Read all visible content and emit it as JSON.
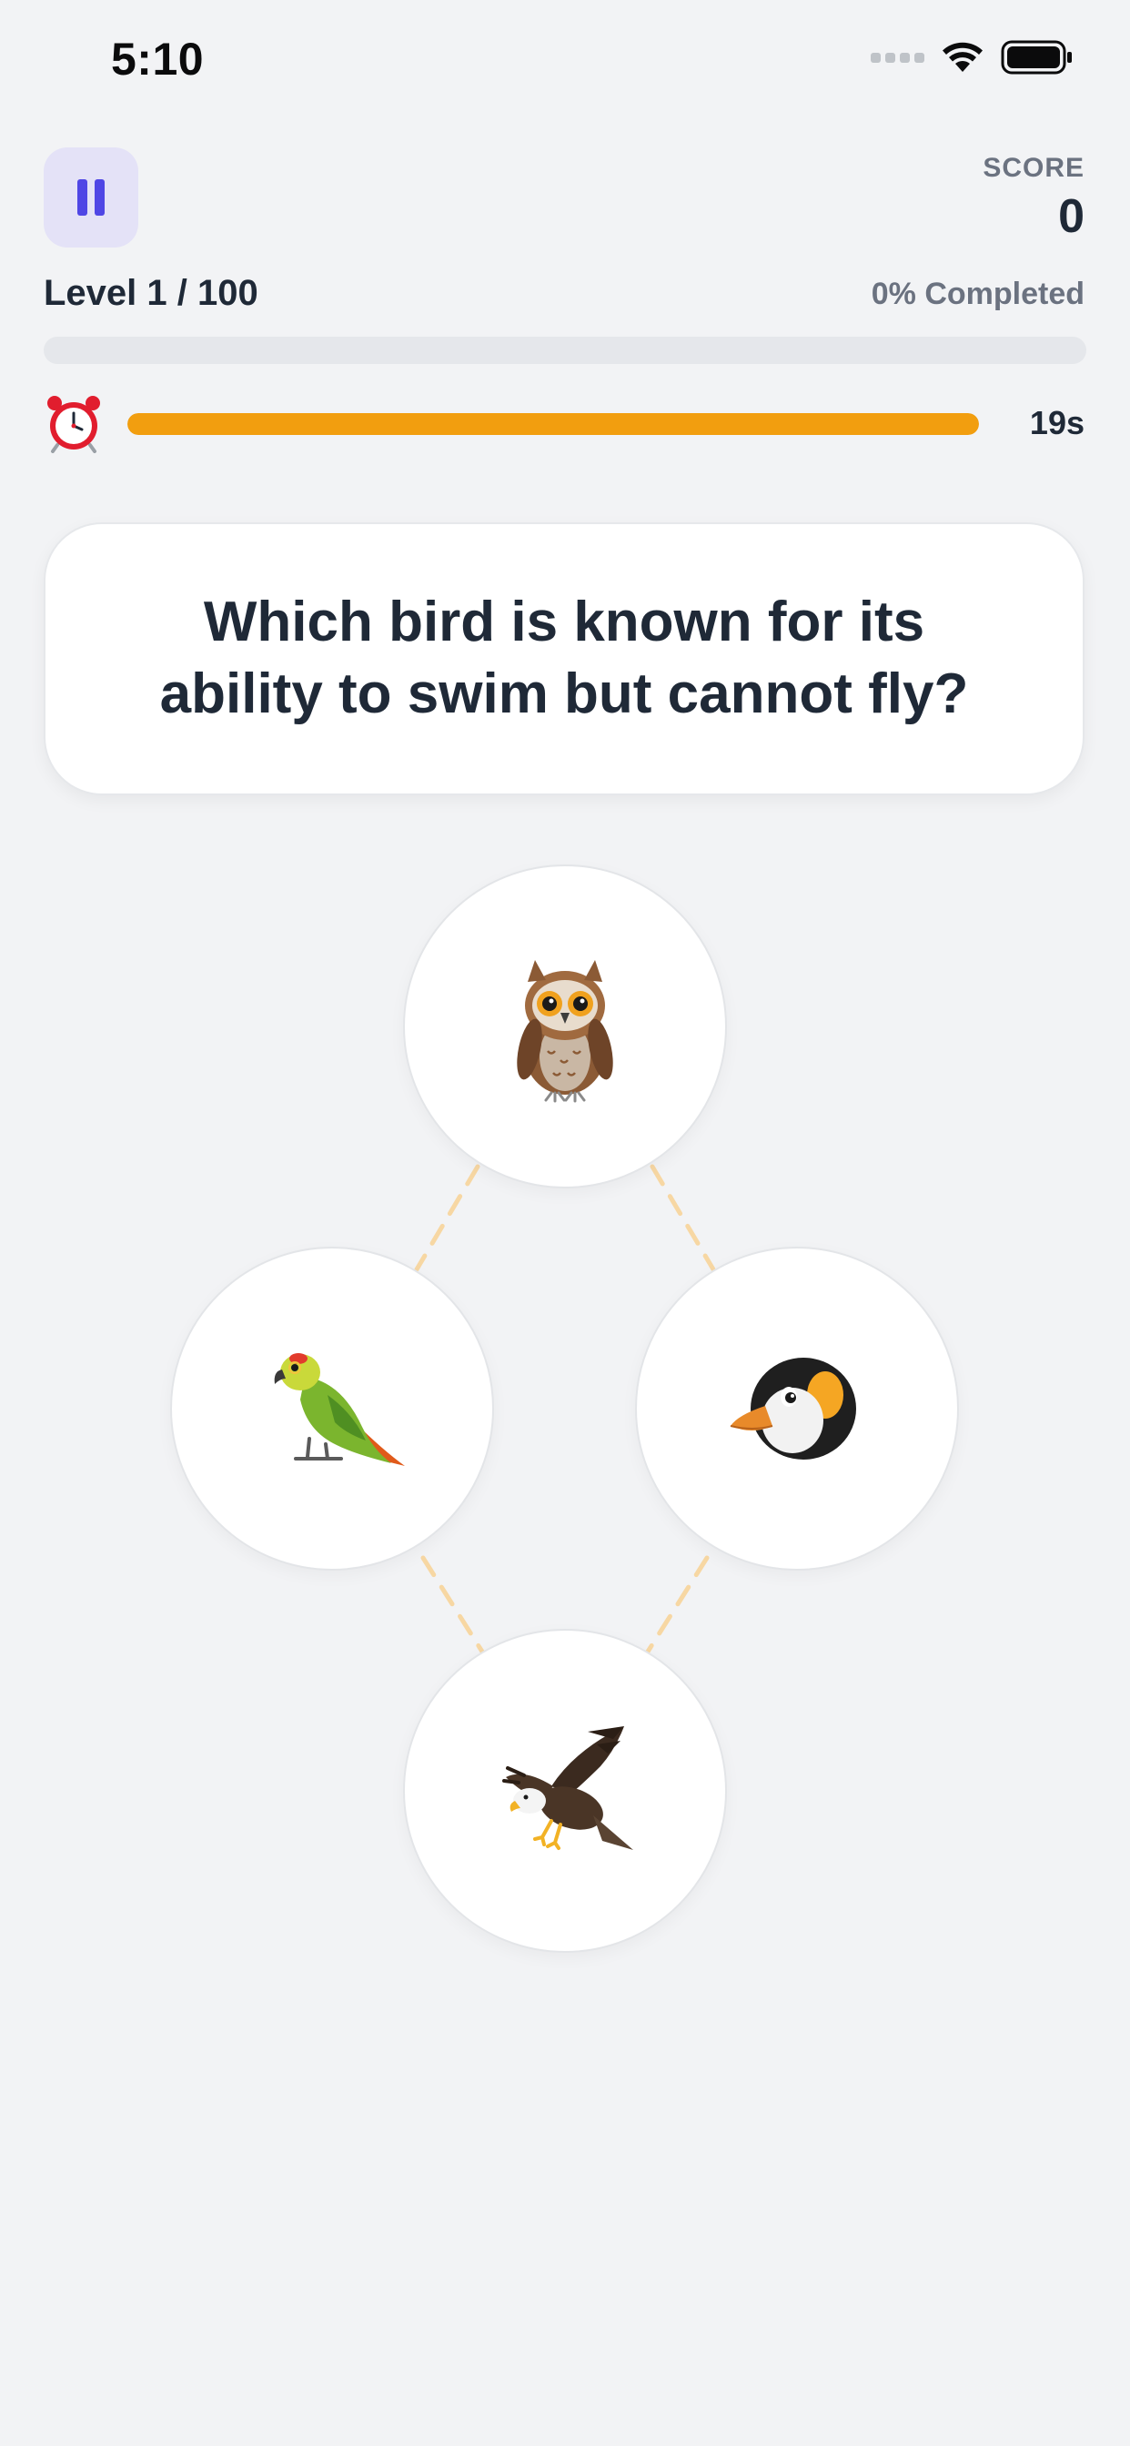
{
  "status_bar": {
    "time": "5:10"
  },
  "header": {
    "score_label": "SCORE",
    "score_value": "0",
    "level_text": "Level 1 / 100",
    "completed_text": "0% Completed",
    "progress_fraction": 0
  },
  "timer": {
    "text": "19s",
    "fraction_remaining": 1,
    "icon": "alarm-clock-icon"
  },
  "question": {
    "text": "Which bird is known for its ability to swim but cannot fly?"
  },
  "options": [
    {
      "icon": "owl-icon"
    },
    {
      "icon": "parrot-icon"
    },
    {
      "icon": "penguin-icon"
    },
    {
      "icon": "eagle-icon"
    }
  ],
  "colors": {
    "background": "#f2f3f5",
    "pause_button_bg": "#e4e2f7",
    "pause_icon": "#4f46e5",
    "timer_fill": "#f29e0f",
    "connector": "#f7d7a3"
  }
}
